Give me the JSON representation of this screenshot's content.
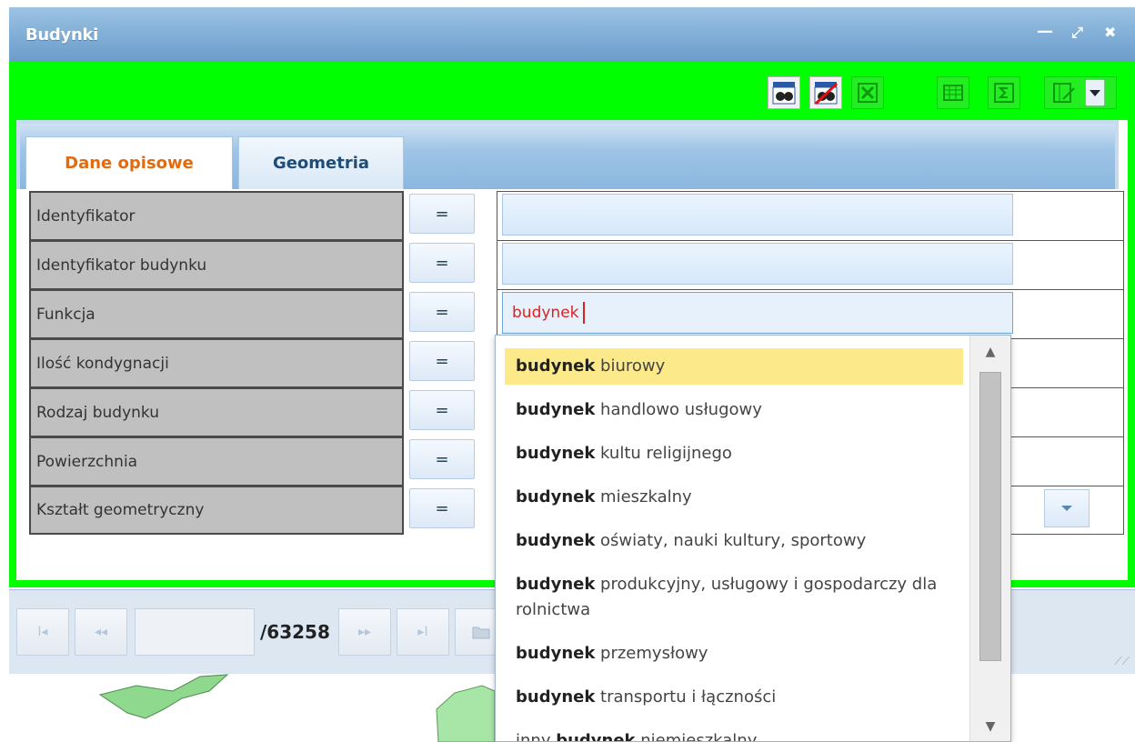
{
  "window": {
    "title": "Budynki",
    "controls": {
      "minimize": "—",
      "restore": "⤢",
      "close": "✖"
    }
  },
  "colors": {
    "panel_accent": "#00ff00",
    "active_tab": "#e36b0f",
    "highlight": "#fbe98a",
    "input_text": "#e02020"
  },
  "toolbar": {
    "buttons": [
      {
        "icon": "search-binoculars-icon",
        "enabled": true
      },
      {
        "icon": "clear-search-icon",
        "enabled": true
      },
      {
        "icon": "excel-export-icon",
        "enabled": false
      },
      {
        "icon": "table-view-icon",
        "enabled": false
      },
      {
        "icon": "sum-icon",
        "enabled": false
      },
      {
        "icon": "column-config-icon",
        "enabled": false
      }
    ]
  },
  "tabs": [
    {
      "label": "Dane opisowe",
      "active": true
    },
    {
      "label": "Geometria",
      "active": false
    }
  ],
  "fields": [
    {
      "label": "Identyfikator",
      "operator": "=",
      "value": ""
    },
    {
      "label": "Identyfikator budynku",
      "operator": "=",
      "value": ""
    },
    {
      "label": "Funkcja",
      "operator": "=",
      "value": "budynek"
    },
    {
      "label": "Ilość kondygnacji",
      "operator": "=",
      "value": ""
    },
    {
      "label": "Rodzaj budynku",
      "operator": "=",
      "value": ""
    },
    {
      "label": "Powierzchnia",
      "operator": "=",
      "value": ""
    },
    {
      "label": "Kształt geometryczny",
      "operator": "=",
      "value": ""
    }
  ],
  "paging": {
    "first": "I◂",
    "prev": "◂◂",
    "next": "▸▸",
    "last": "▸I",
    "total": "/63258"
  },
  "dropdown": {
    "items": [
      {
        "pre": "",
        "match": "budynek",
        "rest": " biurowy"
      },
      {
        "pre": "",
        "match": "budynek",
        "rest": " handlowo usługowy"
      },
      {
        "pre": "",
        "match": "budynek",
        "rest": " kultu religijnego"
      },
      {
        "pre": "",
        "match": "budynek",
        "rest": " mieszkalny"
      },
      {
        "pre": "",
        "match": "budynek",
        "rest": " oświaty, nauki kultury, sportowy"
      },
      {
        "pre": "",
        "match": "budynek",
        "rest": " produkcyjny, usługowy i gospodarczy dla rolnictwa"
      },
      {
        "pre": "",
        "match": "budynek",
        "rest": " przemysłowy"
      },
      {
        "pre": "",
        "match": "budynek",
        "rest": " transportu i łączności"
      },
      {
        "pre": "inny ",
        "match": "budynek",
        "rest": " niemieszkalny"
      }
    ],
    "highlighted_index": 0,
    "scroll_up": "▲",
    "scroll_down": "▼"
  }
}
